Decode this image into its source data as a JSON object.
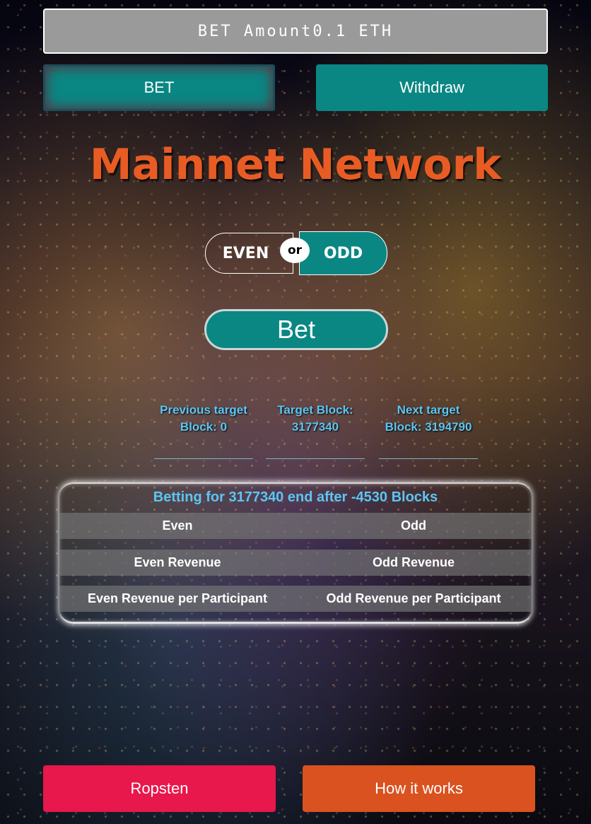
{
  "bet_amount": "BET Amount0.1 ETH",
  "buttons": {
    "bet_top": "BET",
    "withdraw": "Withdraw",
    "bet_main": "Bet",
    "ropsten": "Ropsten",
    "how_it_works": "How it works"
  },
  "title": "Mainnet Network",
  "toggle": {
    "even": "EVEN",
    "or": "or",
    "odd": "ODD",
    "selected": "ODD"
  },
  "blocks": {
    "previous": "Previous target Block: 0",
    "target": "Target Block: 3177340",
    "next": "Next target Block: 3194790"
  },
  "panel": {
    "title": "Betting for 3177340 end after -4530 Blocks",
    "rows": [
      {
        "left": "Even",
        "right": "Odd"
      },
      {
        "left": "Even Revenue",
        "right": "Odd Revenue"
      },
      {
        "left": "Even Revenue per Participant",
        "right": "Odd Revenue per Participant"
      }
    ]
  },
  "colors": {
    "teal": "#0a8783",
    "title_orange": "#e85c24",
    "info_blue": "#5cc6f2",
    "ropsten_red": "#e8174c",
    "how_orange": "#d9521f"
  }
}
